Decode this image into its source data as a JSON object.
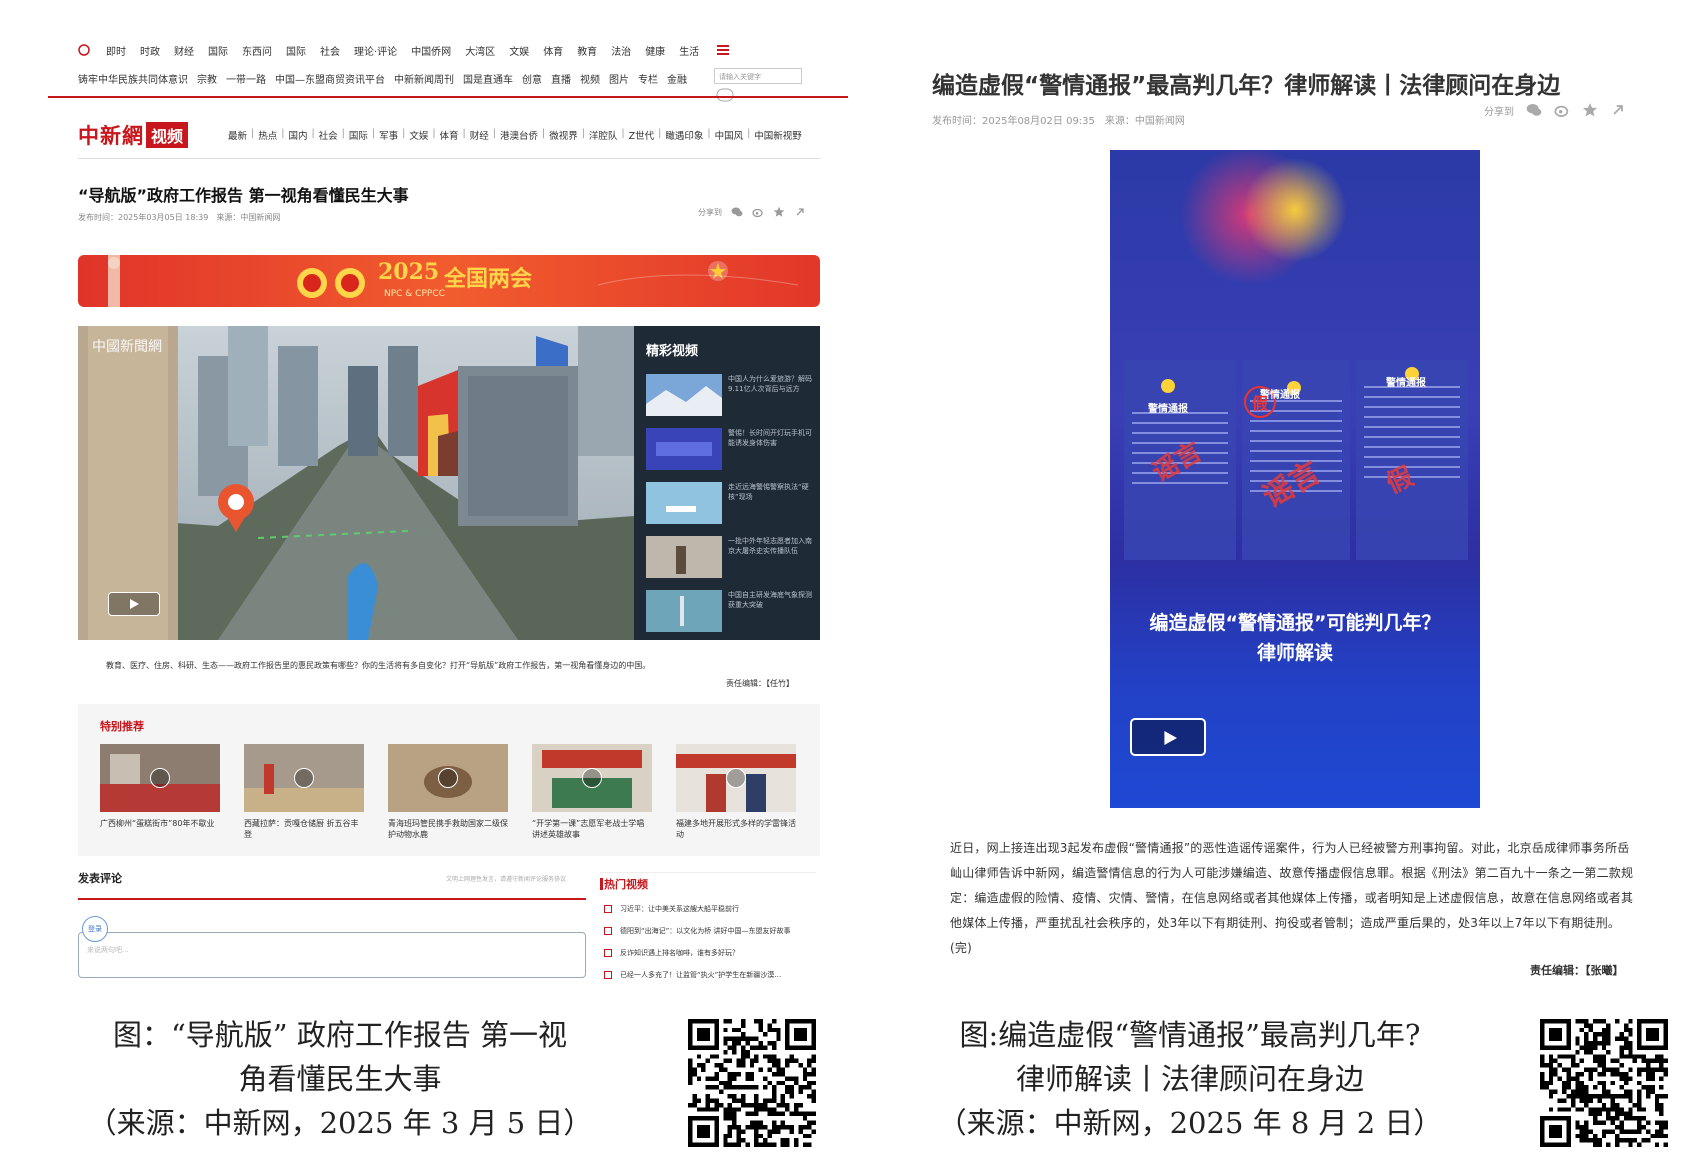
{
  "left": {
    "top_nav": [
      "即时",
      "时政",
      "财经",
      "国际",
      "东西问",
      "国际",
      "社会",
      "理论·评论",
      "中国侨网",
      "大湾区",
      "文娱",
      "体育",
      "教育",
      "法治",
      "健康",
      "生活"
    ],
    "sub_nav": [
      "铸牢中华民族共同体意识",
      "宗教",
      "一带一路",
      "中国—东盟商贸资讯平台",
      "中新新闻周刊",
      "国是直通车",
      "创意",
      "直播",
      "视频",
      "图片",
      "专栏",
      "金融"
    ],
    "search_placeholder": "请输入关键字",
    "logo_cn": "中新網",
    "logo_video": "视频",
    "channel_nav": [
      "最新",
      "热点",
      "国内",
      "社会",
      "国际",
      "军事",
      "文娱",
      "体育",
      "财经",
      "港澳台侨",
      "微视界",
      "洋腔队",
      "Z世代",
      "瞰遇印象",
      "中国风",
      "中国新视野"
    ],
    "article_title": "“导航版”政府工作报告 第一视角看懂民生大事",
    "article_meta": "发布时间：2025年03月05日 18:39　来源：中国新闻网",
    "share_label": "分享到",
    "banner_year": "2025",
    "banner_text": "全国两会",
    "banner_sub": "NPC & CPPCC",
    "video_watermark": "中國新聞網",
    "side_heading": "精彩视频",
    "side_items": [
      "中国人为什么爱旅游？解码9.11亿人次背后与远方",
      "警惕！长时间开灯玩手机可能诱发身体伤害",
      "走近远海警惕警察执法“硬核”现场",
      "一批中外年轻志愿者加入南京大屠杀史实传播队伍",
      "中国自主研发海底气象探测获重大突破"
    ],
    "description": "教育、医疗、住房、科研、生态——政府工作报告里的惠民政策有哪些？你的生活将有多自变化？打开“导航版”政府工作报告，第一视角看懂身边的中国。",
    "editor": "责任编辑：【任竹】",
    "recommend_heading": "特别推荐",
    "recommend_items": [
      "广西柳州“蛋糕街市”80年不歇业",
      "西藏拉萨：贡嘎仓储厨 折五谷丰登",
      "青海班玛管民携手救助国家二级保护动物水鹿",
      "“开学第一课”志愿军老战士学唱讲述英雄故事",
      "福建多地开展形式多样的学雷锋活动"
    ],
    "comment_heading": "发表评论",
    "comment_note": "文明上网理性发言，请遵守新闻评论服务协议",
    "comment_avatar": "登录",
    "comment_placeholder": "来说两句吧...",
    "hot_heading": "热门视频",
    "hot_items": [
      "习近平：让中美关系这艘大船平稳前行",
      "德阳到“出海记”：以文化为桥 讲好中国—东盟友好故事",
      "反诈知识遇上排名咖啡，谁有多好玩？",
      "已经一人多充了！让监管“执火”护学生在新疆沙漠…"
    ]
  },
  "right": {
    "title": "编造虚假“警情通报”最高判几年？律师解读丨法律顾问在身边",
    "meta": "发布时间：2025年08月02日 09:35　来源：中国新闻网",
    "share_label": "分享到",
    "notice_title": "警情通报",
    "stamp_fake": "假",
    "stamp_rumor": "谣言",
    "video_title_line1": "编造虚假“警情通报”可能判几年？",
    "video_title_line2": "律师解读",
    "body": "近日，网上接连出现3起发布虚假“警情通报”的恶性造谣传谣案件，行为人已经被警方刑事拘留。对此，北京岳成律师事务所岳屾山律师告诉中新网，编造警情信息的行为人可能涉嫌编造、故意传播虚假信息罪。根据《刑法》第二百九十一条之一第二款规定：编造虚假的险情、疫情、灾情、警情，在信息网络或者其他媒体上传播，或者明知是上述虚假信息，故意在信息网络或者其他媒体上传播，严重扰乱社会秩序的，处3年以下有期徒刑、拘役或者管制；造成严重后果的，处3年以上7年以下有期徒刑。(完)",
    "editor": "责任编辑：【张曦】"
  },
  "captions": {
    "left_lines": [
      "图：“导航版” 政府工作报告 第一视",
      "角看懂民生大事",
      "（来源：中新网，2025 年 3 月 5 日）"
    ],
    "right_lines": [
      "图:编造虚假“警情通报”最高判几年?",
      "律师解读丨法律顾问在身边",
      "（来源：中新网，2025 年 8 月 2 日）"
    ]
  },
  "colors": {
    "brand_red": "#c8161d",
    "banner_gold": "#ffd54a",
    "video_blue": "#2b3aa6"
  }
}
